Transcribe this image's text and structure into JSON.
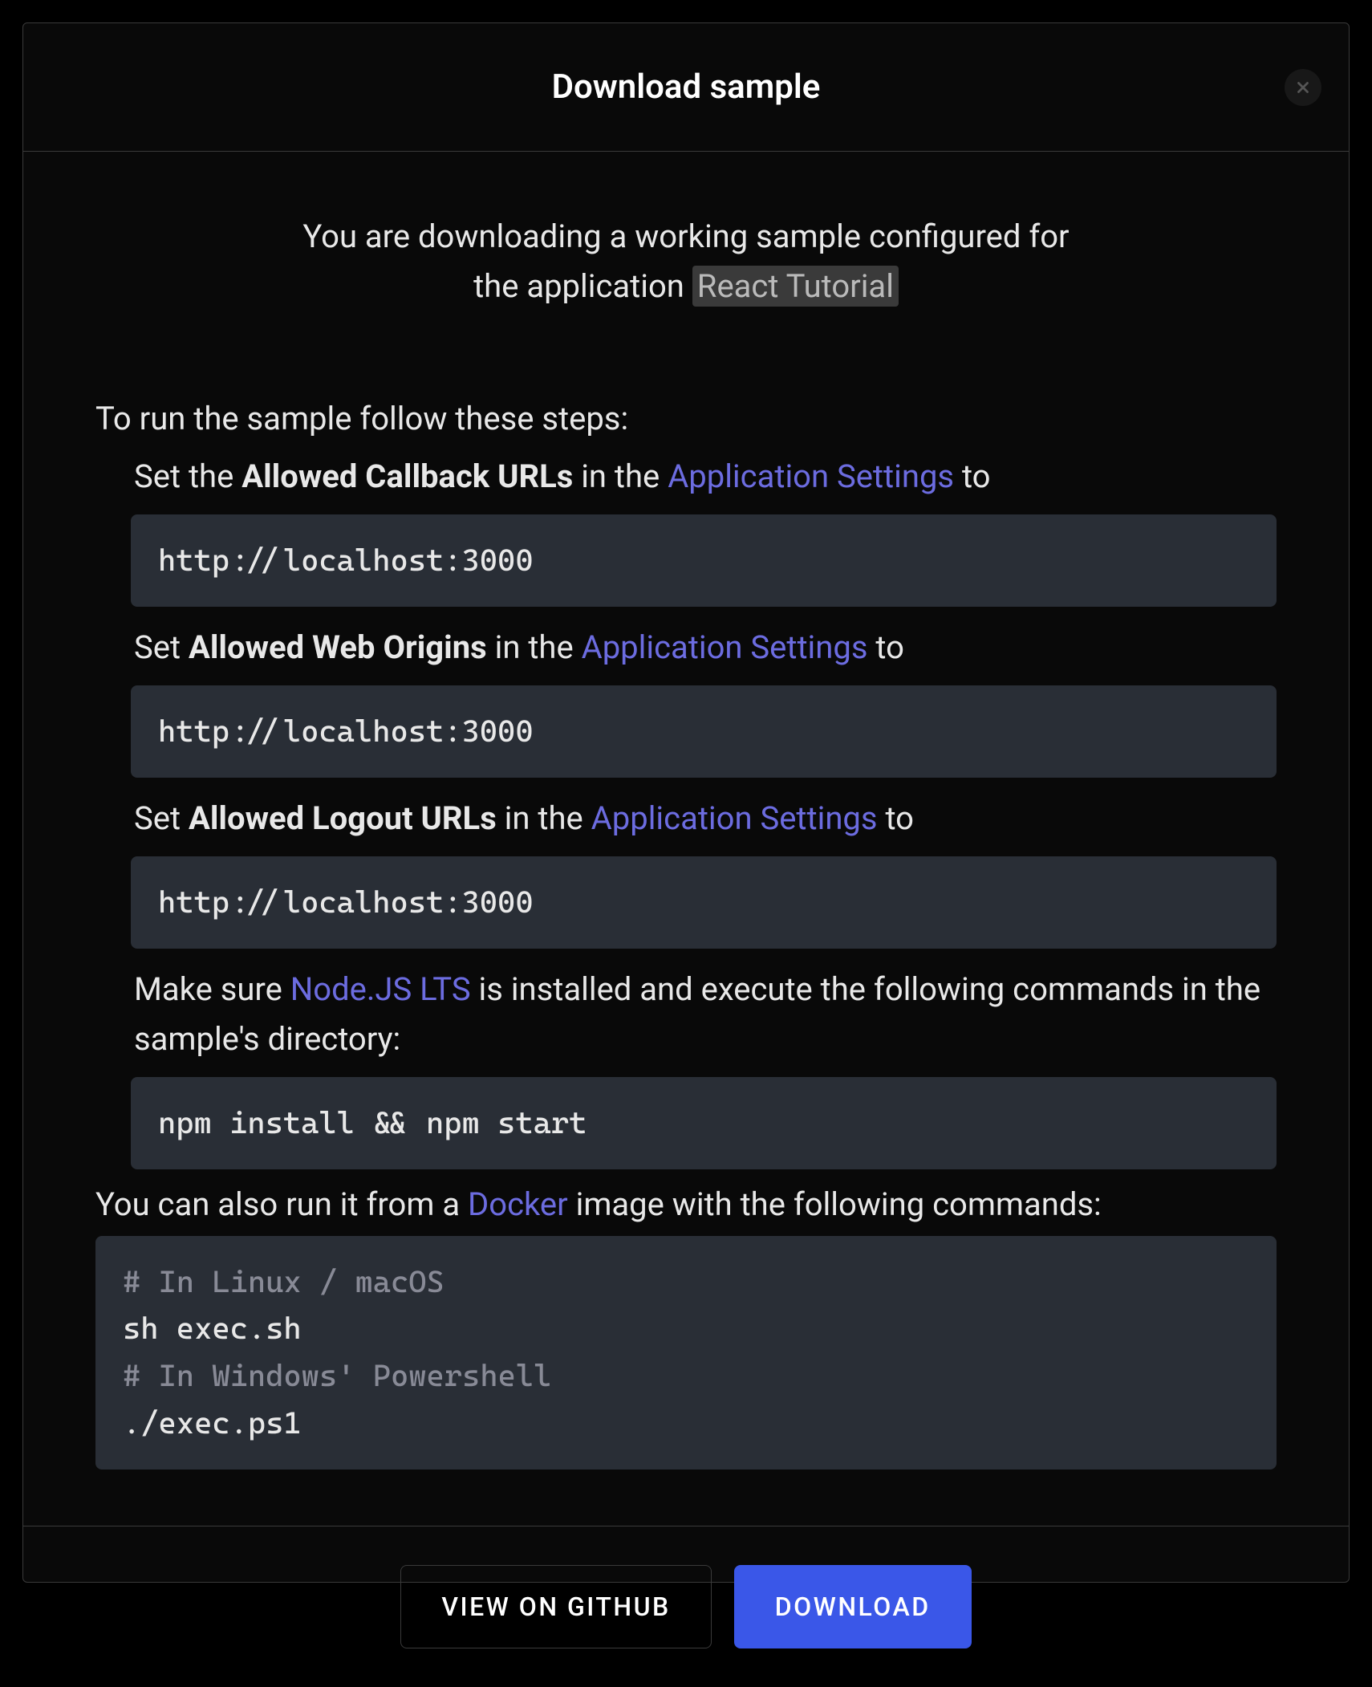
{
  "dialog": {
    "title": "Download sample"
  },
  "intro": {
    "prefix": "You are downloading a working sample configured for",
    "line2_prefix": "the application ",
    "app_name": "React Tutorial"
  },
  "steps_intro": "To run the sample follow these steps:",
  "steps": {
    "step1": {
      "prefix": "Set the ",
      "bold": "Allowed Callback URLs",
      "mid": " in the ",
      "link": "Application Settings",
      "suffix": " to",
      "code": "http://localhost:3000"
    },
    "step2": {
      "prefix": "Set ",
      "bold": "Allowed Web Origins",
      "mid": " in the ",
      "link": "Application Settings",
      "suffix": " to",
      "code": "http://localhost:3000"
    },
    "step3": {
      "prefix": "Set ",
      "bold": "Allowed Logout URLs",
      "mid": " in the ",
      "link": "Application Settings",
      "suffix": " to",
      "code": "http://localhost:3000"
    },
    "step4": {
      "prefix": "Make sure ",
      "link": "Node.JS LTS",
      "suffix": " is installed and execute the following commands in the sample's directory:",
      "code": "npm install && npm start"
    }
  },
  "docker": {
    "intro_prefix": "You can also run it from a ",
    "link": "Docker",
    "intro_suffix": " image with the following commands:",
    "code": {
      "line1_comment": "# In Linux / macOS",
      "line2": "sh exec.sh",
      "line3_comment": "# In Windows' Powershell",
      "line4": "./exec.ps1"
    }
  },
  "footer": {
    "github_label": "VIEW ON GITHUB",
    "download_label": "DOWNLOAD"
  }
}
